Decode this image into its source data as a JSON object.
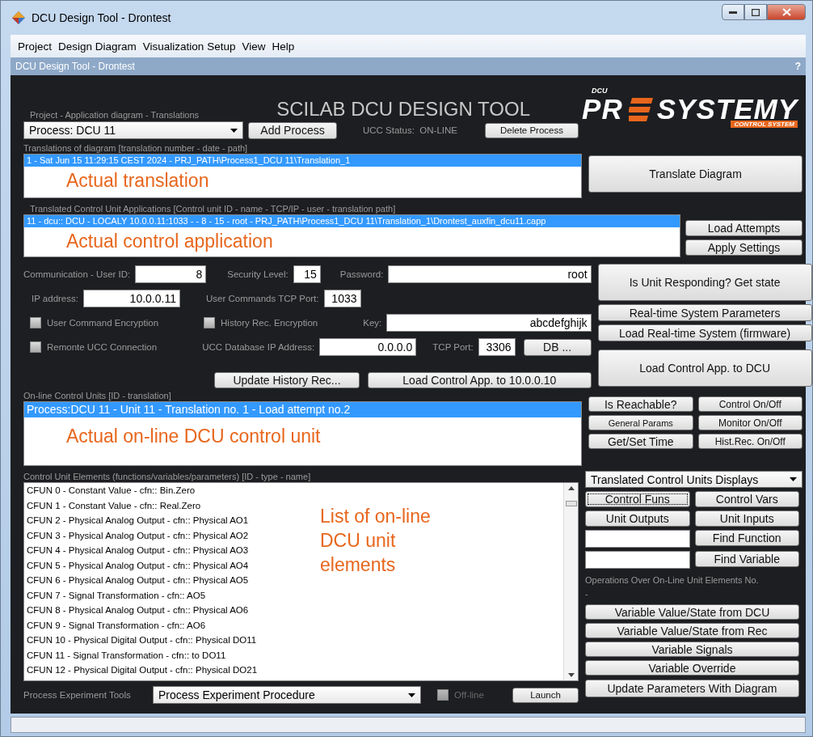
{
  "window": {
    "title": "DCU Design Tool - Drontest"
  },
  "menu": [
    "Project",
    "Design Diagram",
    "Visualization Setup",
    "View",
    "Help"
  ],
  "subheader": {
    "title": "DCU Design Tool - Drontest",
    "help": "?"
  },
  "header": {
    "title": "SCILAB DCU DESIGN TOOL",
    "logo": {
      "badge": "DCU",
      "left": "PR",
      "right": "SYSTEMY",
      "tagline": "CONTROL SYSTEM"
    }
  },
  "project": {
    "label": "Project - Application diagram - Translations",
    "process": "Process: DCU 11",
    "add": "Add Process",
    "status": "UCC Status:  ON-LINE",
    "delete": "Delete Process"
  },
  "translations": {
    "label": "Translations of diagram [translation number - date - path]",
    "rows": [
      {
        "text": "1  -  Sat Jun 15 11:29:15 CEST 2024  -  PRJ_PATH\\Process1_DCU 11\\Translation_1",
        "selected": true
      }
    ],
    "annotation": "Actual translation",
    "button": "Translate Diagram"
  },
  "applications": {
    "label": "Translated Control Unit Applications [Control unit ID - name - TCP/IP - user - translation path]",
    "rows": [
      {
        "text": "11  -  dcu:: DCU  -  LOCALY 10.0.0.11:1033  -   - 8  -  15  -  root  -  PRJ_PATH\\Process1_DCU 11\\Translation_1\\Drontest_auxfin_dcu11.capp",
        "selected": true
      }
    ],
    "annotation": "Actual control application",
    "buttons": [
      "Load Attempts",
      "Apply Settings"
    ]
  },
  "settings": {
    "rows": [
      [
        {
          "kind": "field",
          "label": "Communication - User ID:",
          "value": "8"
        },
        {
          "kind": "field",
          "label": "Security Level:",
          "value": "15"
        },
        {
          "kind": "field",
          "label": "Password:",
          "value": "root"
        }
      ],
      [
        {
          "kind": "field",
          "label": "IP address:",
          "value": "10.0.0.11"
        },
        {
          "kind": "field",
          "label": "User Commands TCP Port:",
          "value": "1033"
        }
      ],
      [
        {
          "kind": "checkbox",
          "label": "User Command Encryption",
          "checked": false
        },
        {
          "kind": "checkbox",
          "label": "History Rec. Encryption",
          "checked": false
        },
        {
          "kind": "field",
          "label": "Key:",
          "value": "abcdefghijk"
        }
      ],
      [
        {
          "kind": "checkbox",
          "label": "Remonte UCC Connection",
          "checked": false
        },
        {
          "kind": "field",
          "label": "UCC Database IP Address:",
          "value": "0.0.0.0"
        },
        {
          "kind": "field",
          "label": "TCP Port:",
          "value": "3306"
        },
        {
          "kind": "button",
          "label": "DB ..."
        }
      ]
    ],
    "buttons": [
      "Update History Rec...",
      "Load Control App. to 10.0.0.10"
    ],
    "side_buttons": [
      "Is Unit Responding? Get state",
      "Real-time System Parameters",
      "Load Real-time System (firmware)",
      "Load Control App. to DCU"
    ]
  },
  "online": {
    "label": "On-line Control Units [ID - translation]",
    "rows": [
      {
        "text": "Process:DCU 11 - Unit 11 - Translation no. 1 - Load attempt no.2",
        "selected": true
      }
    ],
    "annotation": "Actual on-line DCU control unit",
    "buttons": [
      "Is Reachable?",
      "Control On/Off",
      "General Params",
      "Monitor On/Off",
      "Get/Set Time",
      "Hist.Rec. On/Off"
    ]
  },
  "elements": {
    "label": "Control Unit Elements (functions/variables/parameters) [ID - type - name]",
    "rows": [
      "CFUN 0 - Constant Value - cfn:: Bin.Zero",
      "CFUN 1 - Constant Value - cfn:: Real.Zero",
      "CFUN 2 - Physical Analog Output - cfn:: Physical AO1",
      "CFUN 3 - Physical Analog Output - cfn:: Physical AO2",
      "CFUN 4 - Physical Analog Output - cfn:: Physical AO3",
      "CFUN 5 - Physical Analog Output - cfn:: Physical AO4",
      "CFUN 6 - Physical Analog Output - cfn:: Physical AO5",
      "CFUN 7 - Signal Transformation - cfn:: AO5",
      "CFUN 8 - Physical Analog Output - cfn:: Physical AO6",
      "CFUN 9 - Signal Transformation - cfn:: AO6",
      "CFUN 10 - Physical Digital Output - cfn:: Physical DO11",
      "CFUN 11 - Signal Transformation - cfn:: to DO11",
      "CFUN 12 - Physical Digital Output - cfn:: Physical DO21"
    ],
    "annotation": "List of on-line DCU unit elements"
  },
  "displays": {
    "select": "Translated Control Units Displays",
    "buttons": [
      {
        "label": "Control Funs",
        "focused": true
      },
      {
        "label": "Control Vars",
        "focused": false
      },
      {
        "label": "Unit Outputs",
        "focused": false
      },
      {
        "label": "Unit Inputs",
        "focused": false
      }
    ],
    "finders": [
      "Find Function",
      "Find Variable"
    ],
    "operations_label": "Operations Over On-Line Unit Elements No.",
    "operations_value": "-",
    "actions": [
      "Variable Value/State from DCU",
      "Variable Value/State from Rec",
      "Variable Signals",
      "Variable Override",
      "Update Parameters With Diagram"
    ]
  },
  "tools": {
    "label": "Process Experiment Tools",
    "select": "Process Experiment Procedure",
    "offline": {
      "label": "Off-line",
      "checked": false,
      "disabled": true
    },
    "launch": "Launch"
  }
}
